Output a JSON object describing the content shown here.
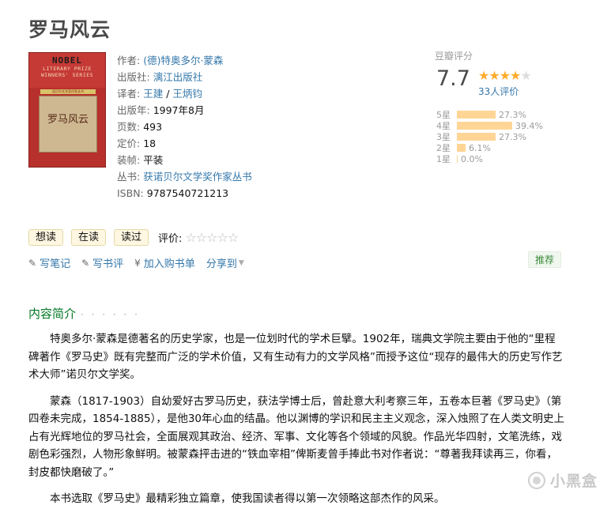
{
  "book": {
    "title": "罗马风云",
    "cover": {
      "top_text": "NOBEL",
      "series_line1": "LITERARY  PRIZE",
      "series_line2": "WINNERS'  SERIES",
      "panel_title": "罗马风云",
      "ribbon": "诺贝尔文学奖作家丛书"
    },
    "info": [
      {
        "label": "作者:",
        "value": "(德)特奥多尔·蒙森",
        "link": true
      },
      {
        "label": "出版社:",
        "value": "漓江出版社",
        "link": true
      },
      {
        "label": "译者:",
        "value": "王建",
        "link": true,
        "sep": " / ",
        "value2": "王炳钧"
      },
      {
        "label": "出版年:",
        "value": "1997年8月",
        "link": false
      },
      {
        "label": "页数:",
        "value": "493",
        "link": false
      },
      {
        "label": "定价:",
        "value": "18",
        "link": false
      },
      {
        "label": "装帧:",
        "value": "平装",
        "link": false
      },
      {
        "label": "丛书:",
        "value": "获诺贝尔文学奖作家丛书",
        "link": true
      },
      {
        "label": "ISBN:",
        "value": "9787540721213",
        "link": false
      }
    ]
  },
  "rating": {
    "header": "豆瓣评分",
    "score": "7.7",
    "stars_filled": 4,
    "stars_total": 5,
    "count": "33人评价",
    "distribution": [
      {
        "label": "5星",
        "percent": 27.3,
        "text": "27.3%"
      },
      {
        "label": "4星",
        "percent": 39.4,
        "text": "39.4%"
      },
      {
        "label": "3星",
        "percent": 27.3,
        "text": "27.3%"
      },
      {
        "label": "2星",
        "percent": 6.1,
        "text": "6.1%"
      },
      {
        "label": "1星",
        "percent": 0.0,
        "text": "0.0%"
      }
    ]
  },
  "actions": {
    "want": "想读",
    "reading": "在读",
    "read": "读过",
    "rate_label": "评价:",
    "rate_stars": "☆☆☆☆☆"
  },
  "links": {
    "note": "写笔记",
    "review": "写书评",
    "cart": "加入购书单",
    "share": "分享到",
    "recommend": "推荐"
  },
  "content": {
    "heading": "内容简介",
    "dots": "· · · · · ·",
    "paragraphs": [
      "特奥多尔·蒙森是德著名的历史学家，也是一位划时代的学术巨擘。1902年，瑞典文学院主要由于他的“里程碑著作《罗马史》既有完整而广泛的学术价值，又有生动有力的文学风格”而授予这位“现存的最伟大的历史写作艺术大师”诺贝尔文学奖。",
      "蒙森（1817-1903）自幼爱好古罗马历史，获法学博士后，曾赴意大利考察三年，五卷本巨著《罗马史》（第四卷未完成，1854-1885），是他30年心血的结晶。他以渊博的学识和民主主义观念，深入烛照了在人类文明史上占有光辉地位的罗马社会，全面展观其政治、经济、军事、文化等各个领域的风貌。作品光华四射，文笔洗练，戏剧色彩强烈，人物形象鲜明。被蒙森抨击进的“铁血宰相”俾斯麦曾手捧此书对作者说：“尊著我拜读再三，你看，封皮都快磨破了。”",
      "本书选取《罗马史》最精彩独立篇章，使我国读者得以第一次领略这部杰作的风采。"
    ]
  },
  "watermark": "小黑盒"
}
